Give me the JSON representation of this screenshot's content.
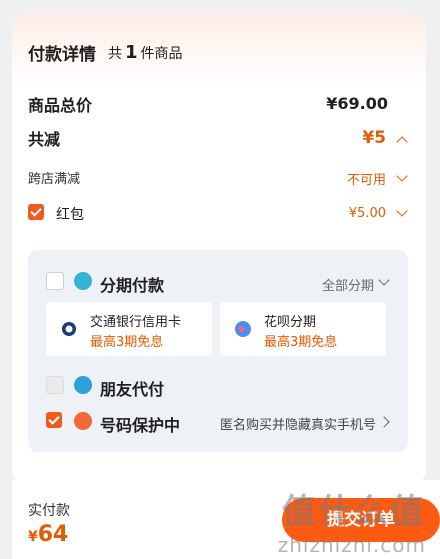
{
  "header": {
    "title": "付款详情",
    "prefix": "共",
    "count": "1",
    "suffix": "件商品"
  },
  "summary": {
    "total_label": "商品总价",
    "total_value": "¥69.00",
    "discount_label": "共减",
    "discount_value": "¥5",
    "store_label": "跨店满减",
    "store_value": "不可用",
    "hongbao_label": "红包",
    "hongbao_value": "¥5.00"
  },
  "installment": {
    "label": "分期付款",
    "option_label": "全部分期",
    "options": [
      {
        "name": "交通银行信用卡",
        "promo": "最高3期免息"
      },
      {
        "name": "花呗分期",
        "promo": "最高3期免息"
      }
    ]
  },
  "friend_pay": {
    "label": "朋友代付"
  },
  "number_protect": {
    "label": "号码保护中",
    "hint": "匿名购买并隐藏真实手机号"
  },
  "footer": {
    "actual_label": "实付款",
    "actual_currency": "¥",
    "actual_amount": "64",
    "submit_label": "提交订单"
  },
  "watermark": {
    "top": "值什么值",
    "bottom": "zhizhizhi.com"
  },
  "colors": {
    "accent": "#e65a00",
    "submit": "#ff5a12",
    "panel": "#eef2f6"
  }
}
